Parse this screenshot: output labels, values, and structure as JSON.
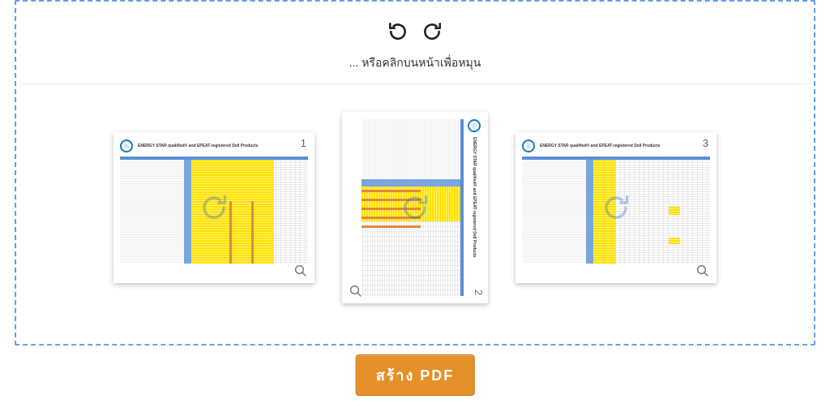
{
  "instruction_text": "... หรือคลิกบนหน้าเพื่อหมุน",
  "create_button_label": "สร้าง PDF",
  "icons": {
    "rotate_left": "rotate-left-icon",
    "rotate_right": "rotate-right-icon",
    "zoom": "magnifier-icon",
    "overlay": "rotate-overlay-icon"
  },
  "document_title": "ENERGY STAR qualified® and EPEAT-registered Dell Products",
  "pages": [
    {
      "number": "1",
      "orientation": "portrait"
    },
    {
      "number": "2",
      "orientation": "landscape"
    },
    {
      "number": "3",
      "orientation": "portrait"
    }
  ]
}
